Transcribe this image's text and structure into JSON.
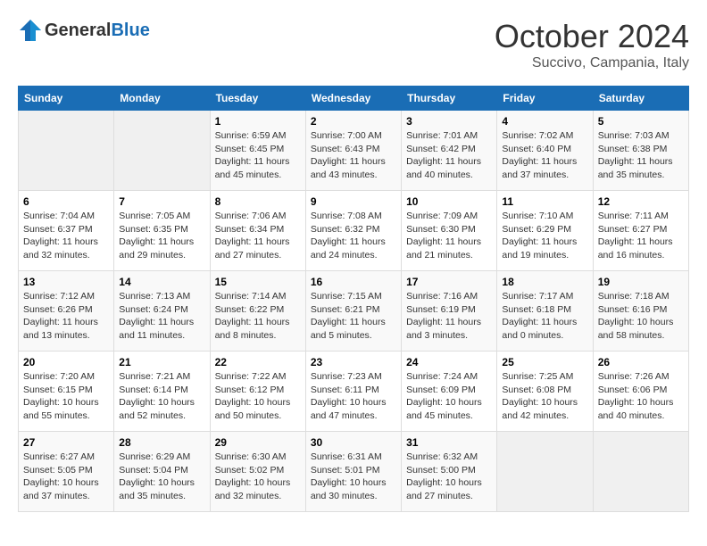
{
  "header": {
    "logo_line1": "General",
    "logo_line2": "Blue",
    "month_title": "October 2024",
    "location": "Succivo, Campania, Italy"
  },
  "weekdays": [
    "Sunday",
    "Monday",
    "Tuesday",
    "Wednesday",
    "Thursday",
    "Friday",
    "Saturday"
  ],
  "weeks": [
    [
      {
        "day": "",
        "info": ""
      },
      {
        "day": "",
        "info": ""
      },
      {
        "day": "1",
        "info": "Sunrise: 6:59 AM\nSunset: 6:45 PM\nDaylight: 11 hours and 45 minutes."
      },
      {
        "day": "2",
        "info": "Sunrise: 7:00 AM\nSunset: 6:43 PM\nDaylight: 11 hours and 43 minutes."
      },
      {
        "day": "3",
        "info": "Sunrise: 7:01 AM\nSunset: 6:42 PM\nDaylight: 11 hours and 40 minutes."
      },
      {
        "day": "4",
        "info": "Sunrise: 7:02 AM\nSunset: 6:40 PM\nDaylight: 11 hours and 37 minutes."
      },
      {
        "day": "5",
        "info": "Sunrise: 7:03 AM\nSunset: 6:38 PM\nDaylight: 11 hours and 35 minutes."
      }
    ],
    [
      {
        "day": "6",
        "info": "Sunrise: 7:04 AM\nSunset: 6:37 PM\nDaylight: 11 hours and 32 minutes."
      },
      {
        "day": "7",
        "info": "Sunrise: 7:05 AM\nSunset: 6:35 PM\nDaylight: 11 hours and 29 minutes."
      },
      {
        "day": "8",
        "info": "Sunrise: 7:06 AM\nSunset: 6:34 PM\nDaylight: 11 hours and 27 minutes."
      },
      {
        "day": "9",
        "info": "Sunrise: 7:08 AM\nSunset: 6:32 PM\nDaylight: 11 hours and 24 minutes."
      },
      {
        "day": "10",
        "info": "Sunrise: 7:09 AM\nSunset: 6:30 PM\nDaylight: 11 hours and 21 minutes."
      },
      {
        "day": "11",
        "info": "Sunrise: 7:10 AM\nSunset: 6:29 PM\nDaylight: 11 hours and 19 minutes."
      },
      {
        "day": "12",
        "info": "Sunrise: 7:11 AM\nSunset: 6:27 PM\nDaylight: 11 hours and 16 minutes."
      }
    ],
    [
      {
        "day": "13",
        "info": "Sunrise: 7:12 AM\nSunset: 6:26 PM\nDaylight: 11 hours and 13 minutes."
      },
      {
        "day": "14",
        "info": "Sunrise: 7:13 AM\nSunset: 6:24 PM\nDaylight: 11 hours and 11 minutes."
      },
      {
        "day": "15",
        "info": "Sunrise: 7:14 AM\nSunset: 6:22 PM\nDaylight: 11 hours and 8 minutes."
      },
      {
        "day": "16",
        "info": "Sunrise: 7:15 AM\nSunset: 6:21 PM\nDaylight: 11 hours and 5 minutes."
      },
      {
        "day": "17",
        "info": "Sunrise: 7:16 AM\nSunset: 6:19 PM\nDaylight: 11 hours and 3 minutes."
      },
      {
        "day": "18",
        "info": "Sunrise: 7:17 AM\nSunset: 6:18 PM\nDaylight: 11 hours and 0 minutes."
      },
      {
        "day": "19",
        "info": "Sunrise: 7:18 AM\nSunset: 6:16 PM\nDaylight: 10 hours and 58 minutes."
      }
    ],
    [
      {
        "day": "20",
        "info": "Sunrise: 7:20 AM\nSunset: 6:15 PM\nDaylight: 10 hours and 55 minutes."
      },
      {
        "day": "21",
        "info": "Sunrise: 7:21 AM\nSunset: 6:14 PM\nDaylight: 10 hours and 52 minutes."
      },
      {
        "day": "22",
        "info": "Sunrise: 7:22 AM\nSunset: 6:12 PM\nDaylight: 10 hours and 50 minutes."
      },
      {
        "day": "23",
        "info": "Sunrise: 7:23 AM\nSunset: 6:11 PM\nDaylight: 10 hours and 47 minutes."
      },
      {
        "day": "24",
        "info": "Sunrise: 7:24 AM\nSunset: 6:09 PM\nDaylight: 10 hours and 45 minutes."
      },
      {
        "day": "25",
        "info": "Sunrise: 7:25 AM\nSunset: 6:08 PM\nDaylight: 10 hours and 42 minutes."
      },
      {
        "day": "26",
        "info": "Sunrise: 7:26 AM\nSunset: 6:06 PM\nDaylight: 10 hours and 40 minutes."
      }
    ],
    [
      {
        "day": "27",
        "info": "Sunrise: 6:27 AM\nSunset: 5:05 PM\nDaylight: 10 hours and 37 minutes."
      },
      {
        "day": "28",
        "info": "Sunrise: 6:29 AM\nSunset: 5:04 PM\nDaylight: 10 hours and 35 minutes."
      },
      {
        "day": "29",
        "info": "Sunrise: 6:30 AM\nSunset: 5:02 PM\nDaylight: 10 hours and 32 minutes."
      },
      {
        "day": "30",
        "info": "Sunrise: 6:31 AM\nSunset: 5:01 PM\nDaylight: 10 hours and 30 minutes."
      },
      {
        "day": "31",
        "info": "Sunrise: 6:32 AM\nSunset: 5:00 PM\nDaylight: 10 hours and 27 minutes."
      },
      {
        "day": "",
        "info": ""
      },
      {
        "day": "",
        "info": ""
      }
    ]
  ]
}
